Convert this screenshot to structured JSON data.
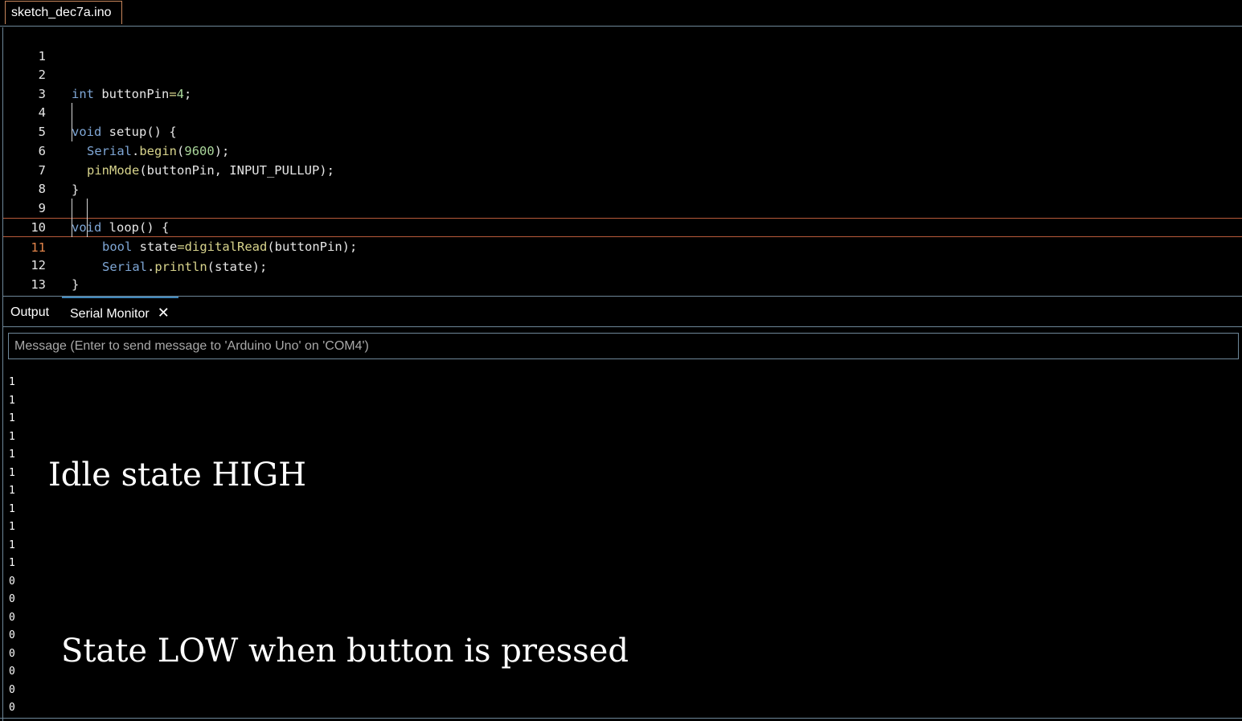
{
  "file_tab": {
    "label": "sketch_dec7a.ino"
  },
  "editor": {
    "active_line": 11,
    "lines": [
      {
        "n": "1"
      },
      {
        "n": "2"
      },
      {
        "n": "3"
      },
      {
        "n": "4"
      },
      {
        "n": "5"
      },
      {
        "n": "6"
      },
      {
        "n": "7"
      },
      {
        "n": "8"
      },
      {
        "n": "9"
      },
      {
        "n": "10"
      },
      {
        "n": "11"
      },
      {
        "n": "12"
      },
      {
        "n": "13"
      }
    ],
    "code": {
      "l2_type": "int",
      "l2_rest": " buttonPin",
      "l2_eq": "=",
      "l2_num": "4",
      "l2_end": ";",
      "l4_type": "void",
      "l4_rest": " setup() {",
      "l5_obj": "Serial",
      "l5_dot": ".",
      "l5_fn": "begin",
      "l5_open": "(",
      "l5_num": "9600",
      "l5_end": ");",
      "l6_fn": "pinMode",
      "l6_rest": "(buttonPin, INPUT_PULLUP);",
      "l7": "}",
      "l9_type": "void",
      "l9_rest": " loop() {",
      "l10_type": "bool",
      "l10_var": " state",
      "l10_eq": "=",
      "l10_fn": "digitalRead",
      "l10_rest": "(buttonPin);",
      "l11_obj": "Serial",
      "l11_dot": ".",
      "l11_fn": "println",
      "l11_rest": "(state);",
      "l12": "}"
    }
  },
  "panel": {
    "tabs": [
      {
        "label": "Output"
      },
      {
        "label": "Serial Monitor"
      }
    ],
    "close_symbol": "✕",
    "message_placeholder": "Message (Enter to send message to 'Arduino Uno' on 'COM4')",
    "serial_output": [
      "1",
      "1",
      "1",
      "1",
      "1",
      "1",
      "1",
      "1",
      "1",
      "1",
      "1",
      "0",
      "0",
      "0",
      "0",
      "0",
      "0",
      "0",
      "0"
    ]
  },
  "annotations": {
    "idle": "Idle state HIGH",
    "pressed": "State LOW when button is pressed"
  }
}
